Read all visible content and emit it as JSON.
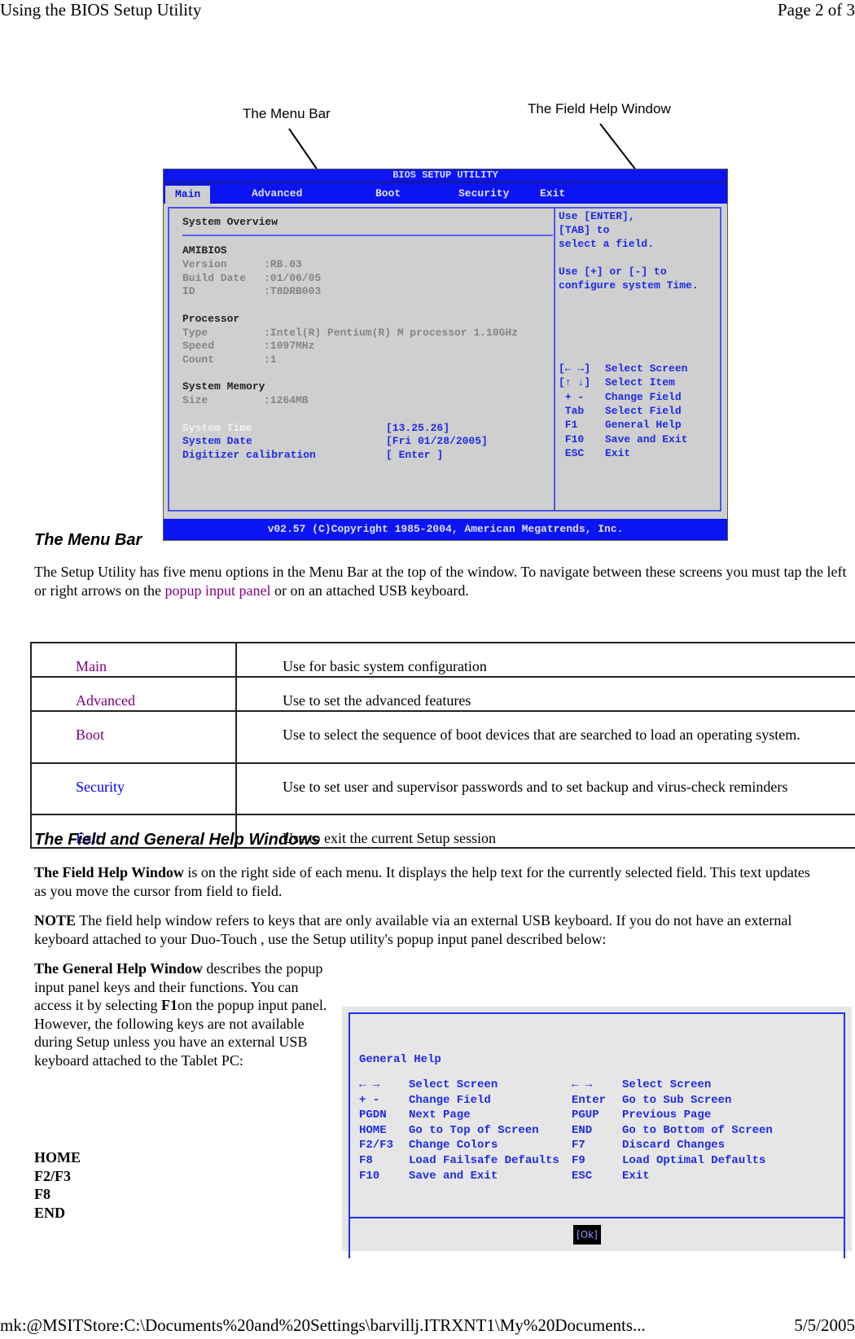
{
  "page_header": {
    "title": "Using the BIOS Setup Utility",
    "page": "Page 2 of 3"
  },
  "callouts": {
    "menu_bar": "The Menu Bar",
    "field_help": "The Field Help Window"
  },
  "bios": {
    "title": "BIOS SETUP UTILITY",
    "menu": [
      "Main",
      "Advanced",
      "Boot",
      "Security",
      "Exit"
    ],
    "active_menu": "Main",
    "overview_title": "System Overview",
    "sections": [
      {
        "heading": "AMIBIOS",
        "rows": [
          {
            "label": "Version",
            "value": ":RB.03"
          },
          {
            "label": "Build Date",
            "value": ":01/06/05"
          },
          {
            "label": "ID",
            "value": ":T8DRB003"
          }
        ]
      },
      {
        "heading": "Processor",
        "rows": [
          {
            "label": "Type",
            "value": ":Intel(R) Pentium(R) M processor 1.10GHz"
          },
          {
            "label": "Speed",
            "value": ":1097MHz"
          },
          {
            "label": "Count",
            "value": ":1"
          }
        ]
      },
      {
        "heading": "System Memory",
        "rows": [
          {
            "label": "Size",
            "value": ":1264MB"
          }
        ]
      }
    ],
    "settings": [
      {
        "label": "System Time",
        "value": "[13.25.26]",
        "selected": true
      },
      {
        "label": "System Date",
        "value": "[Fri 01/28/2005]"
      },
      {
        "label": "Digitizer calibration",
        "value": "[ Enter ]"
      }
    ],
    "help_text": [
      "Use [ENTER],",
      "[TAB] to",
      "select a field.",
      "",
      "Use [+] or [-] to",
      "configure system Time."
    ],
    "help_keys": [
      {
        "key": "[← →]",
        "action": "Select Screen"
      },
      {
        "key": "[↑ ↓]",
        "action": "Select Item"
      },
      {
        "key": " + -",
        "action": "Change Field"
      },
      {
        "key": " Tab",
        "action": "Select Field"
      },
      {
        "key": " F1",
        "action": "General Help"
      },
      {
        "key": " F10",
        "action": "Save and Exit"
      },
      {
        "key": " ESC",
        "action": "Exit"
      }
    ],
    "footer": "v02.57 (C)Copyright 1985-2004, American Megatrends, Inc."
  },
  "section1": {
    "heading": "The Menu Bar",
    "para_before": "The Setup Utility has  five menu options in the Menu Bar at the top of the window. To navigate between these screens you must tap the left or right arrows on the ",
    "para_link": "popup input panel",
    "para_after": " or on an attached USB keyboard.",
    "table": [
      {
        "name": "Main",
        "desc": "Use for basic system configuration"
      },
      {
        "name": "Advanced",
        "desc": "Use to set the advanced features"
      },
      {
        "name": "Boot",
        "desc": "Use to select the sequence of boot devices that are searched to load an operating system."
      },
      {
        "name": "Security",
        "desc": "Use to set user and supervisor passwords and to set backup and virus-check reminders"
      },
      {
        "name": "Exit",
        "desc": "Use to exit the current Setup session"
      }
    ]
  },
  "section2": {
    "heading": "The Field and General Help Windows",
    "p1_bold": "The Field Help Window",
    "p1_rest": " is on the right side of each menu.  It displays the help text for the currently selected field.  This text updates as you move the cursor from field to field.",
    "note_bold": "NOTE",
    "note_rest": "  The field help window refers to keys that are only available via an external USB keyboard.  If you do not have an external keyboard attached to your Duo-Touch , use the Setup utility's popup input panel described below:",
    "p2_bold": "The General Help Window",
    "p2_a": " describes the popup input panel keys and their functions.  You can access it by selecting ",
    "p2_key": "F1",
    "p2_b": "on the popup input panel. However, the following keys are not available during Setup unless you have an external USB keyboard attached to the Tablet PC:",
    "keys": [
      "HOME",
      "F2/F3",
      "F8",
      "END"
    ]
  },
  "general_help": {
    "title": "General Help",
    "left": [
      {
        "key": "← →",
        "action": "Select Screen"
      },
      {
        "key": "+ -",
        "action": "Change Field"
      },
      {
        "key": "PGDN",
        "action": "Next Page"
      },
      {
        "key": "HOME",
        "action": "Go to Top of Screen"
      },
      {
        "key": "F2/F3",
        "action": "Change Colors"
      },
      {
        "key": "F8",
        "action": "Load Failsafe Defaults"
      },
      {
        "key": "F10",
        "action": "Save and Exit"
      }
    ],
    "right": [
      {
        "key": "← →",
        "action": "Select Screen"
      },
      {
        "key": "Enter",
        "action": "Go to Sub Screen"
      },
      {
        "key": "PGUP",
        "action": "Previous Page"
      },
      {
        "key": "END",
        "action": "Go to Bottom of Screen"
      },
      {
        "key": "F7",
        "action": "Discard Changes"
      },
      {
        "key": "F9",
        "action": "Load Optimal Defaults"
      },
      {
        "key": "ESC",
        "action": "Exit"
      }
    ],
    "ok": "[Ok]"
  },
  "page_footer": {
    "path": "mk:@MSITStore:C:\\Documents%20and%20Settings\\barvillj.ITRXNT1\\My%20Documents...",
    "date": "5/5/2005"
  }
}
